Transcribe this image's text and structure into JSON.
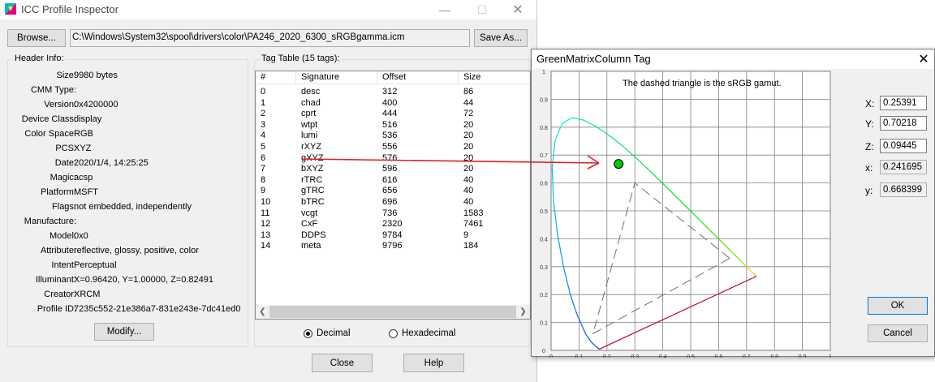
{
  "main_window": {
    "title": "ICC Profile Inspector",
    "browse_label": "Browse...",
    "path_value": "C:\\Windows\\System32\\spool\\drivers\\color\\PA246_2020_6300_sRGBgamma.icm",
    "save_as_label": "Save As...",
    "header_group_label": "Header Info:",
    "header_fields": [
      {
        "key": "Size:",
        "value": "9980 bytes"
      },
      {
        "key": "CMM Type:",
        "value": ""
      },
      {
        "key": "Version:",
        "value": "0x4200000"
      },
      {
        "key": "Device Class:",
        "value": "display"
      },
      {
        "key": "Color Space:",
        "value": "RGB"
      },
      {
        "key": "PCS:",
        "value": "XYZ"
      },
      {
        "key": "Date:",
        "value": "2020/1/4, 14:25:25"
      },
      {
        "key": "Magic:",
        "value": "acsp"
      },
      {
        "key": "Platform:",
        "value": "MSFT"
      },
      {
        "key": "Flags:",
        "value": "not embedded, independently"
      },
      {
        "key": "Manufacture:",
        "value": ""
      },
      {
        "key": "Model:",
        "value": "0x0"
      },
      {
        "key": "Attribute:",
        "value": "reflective, glossy, positive, color"
      },
      {
        "key": "Intent:",
        "value": "Perceptual"
      },
      {
        "key": "Illuminant:",
        "value": "X=0.96420, Y=1.00000, Z=0.82491"
      },
      {
        "key": "Creator:",
        "value": "XRCM"
      },
      {
        "key": "Profile ID:",
        "value": "7235c552-21e386a7-831e243e-7dc41ed0"
      }
    ],
    "modify_label": "Modify...",
    "tag_group_label": "Tag Table (15 tags):",
    "tag_columns": [
      "#",
      "Signature",
      "Offset",
      "Size"
    ],
    "tags": [
      [
        "0",
        "desc",
        "312",
        "86"
      ],
      [
        "1",
        "chad",
        "400",
        "44"
      ],
      [
        "2",
        "cprt",
        "444",
        "72"
      ],
      [
        "3",
        "wtpt",
        "516",
        "20"
      ],
      [
        "4",
        "lumi",
        "536",
        "20"
      ],
      [
        "5",
        "rXYZ",
        "556",
        "20"
      ],
      [
        "6",
        "gXYZ",
        "576",
        "20"
      ],
      [
        "7",
        "bXYZ",
        "596",
        "20"
      ],
      [
        "8",
        "rTRC",
        "616",
        "40"
      ],
      [
        "9",
        "gTRC",
        "656",
        "40"
      ],
      [
        "10",
        "bTRC",
        "696",
        "40"
      ],
      [
        "11",
        "vcgt",
        "736",
        "1583"
      ],
      [
        "12",
        "CxF",
        "2320",
        "7461"
      ],
      [
        "13",
        "DDPS",
        "9784",
        "9"
      ],
      [
        "14",
        "meta",
        "9796",
        "184"
      ]
    ],
    "radio_decimal": "Decimal",
    "radio_hex": "Hexadecimal",
    "number_format": "Decimal",
    "close_label": "Close",
    "help_label": "Help",
    "arrow_color": "#e02020"
  },
  "tag_window": {
    "title": "GreenMatrixColumn Tag",
    "note": "The dashed triangle is the sRGB gamut.",
    "fields": [
      {
        "label": "X:",
        "value": "0.25391",
        "editable": true
      },
      {
        "label": "Y:",
        "value": "0.70218",
        "editable": true
      },
      {
        "label": "Z:",
        "value": "0.09445",
        "editable": true
      },
      {
        "label": "x:",
        "value": "0.241695",
        "editable": false
      },
      {
        "label": "y:",
        "value": "0.668399",
        "editable": false
      }
    ],
    "ok_label": "OK",
    "cancel_label": "Cancel",
    "point_color": "#00cc00"
  },
  "chart_data": {
    "type": "scatter",
    "title": "",
    "xlim": [
      0,
      1
    ],
    "ylim": [
      0,
      1
    ],
    "x_ticks": [
      "0",
      "0.1",
      "0.2",
      "0.3",
      "0.4",
      "0.5",
      "0.6",
      "0.7",
      "0.8",
      "0.9",
      "1"
    ],
    "y_ticks": [
      "0",
      "0.1",
      "0.2",
      "0.3",
      "0.4",
      "0.5",
      "0.6",
      "0.7",
      "0.8",
      "0.9",
      "1"
    ],
    "grid": true,
    "point": {
      "x": 0.241695,
      "y": 0.668399
    },
    "srgb_gamut": [
      [
        0.64,
        0.33
      ],
      [
        0.3,
        0.6
      ],
      [
        0.15,
        0.06
      ]
    ],
    "device_gamut": [
      [
        0.735,
        0.265
      ],
      [
        0.2,
        0.78
      ],
      [
        0.18,
        0.05
      ]
    ],
    "spectral_locus": [
      [
        0.1741,
        0.005
      ],
      [
        0.1738,
        0.0049
      ],
      [
        0.173,
        0.0048
      ],
      [
        0.1714,
        0.0051
      ],
      [
        0.1689,
        0.0069
      ],
      [
        0.1644,
        0.0109
      ],
      [
        0.1566,
        0.0177
      ],
      [
        0.144,
        0.0297
      ],
      [
        0.1241,
        0.0578
      ],
      [
        0.0913,
        0.1327
      ],
      [
        0.0687,
        0.2007
      ],
      [
        0.0454,
        0.295
      ],
      [
        0.0235,
        0.4127
      ],
      [
        0.0082,
        0.5384
      ],
      [
        0.0039,
        0.6548
      ],
      [
        0.0139,
        0.7502
      ],
      [
        0.0389,
        0.812
      ],
      [
        0.0743,
        0.8338
      ],
      [
        0.1142,
        0.8262
      ],
      [
        0.1547,
        0.8059
      ],
      [
        0.1929,
        0.7816
      ],
      [
        0.2296,
        0.7543
      ],
      [
        0.2658,
        0.7243
      ],
      [
        0.3016,
        0.6923
      ],
      [
        0.3373,
        0.6589
      ],
      [
        0.3731,
        0.6245
      ],
      [
        0.4087,
        0.5896
      ],
      [
        0.4441,
        0.5547
      ],
      [
        0.4788,
        0.5202
      ],
      [
        0.5125,
        0.4866
      ],
      [
        0.5448,
        0.4544
      ],
      [
        0.5752,
        0.4242
      ],
      [
        0.6029,
        0.3965
      ],
      [
        0.627,
        0.3725
      ],
      [
        0.6482,
        0.3514
      ],
      [
        0.6658,
        0.334
      ],
      [
        0.6801,
        0.3197
      ],
      [
        0.6915,
        0.3083
      ],
      [
        0.7006,
        0.2993
      ],
      [
        0.7079,
        0.292
      ],
      [
        0.714,
        0.2859
      ],
      [
        0.719,
        0.2809
      ],
      [
        0.723,
        0.277
      ],
      [
        0.726,
        0.274
      ],
      [
        0.7283,
        0.2717
      ],
      [
        0.73,
        0.27
      ],
      [
        0.7311,
        0.2689
      ],
      [
        0.732,
        0.268
      ],
      [
        0.7327,
        0.2673
      ],
      [
        0.7334,
        0.2666
      ],
      [
        0.734,
        0.266
      ],
      [
        0.7344,
        0.2656
      ],
      [
        0.7346,
        0.2654
      ],
      [
        0.7347,
        0.2653
      ]
    ]
  }
}
